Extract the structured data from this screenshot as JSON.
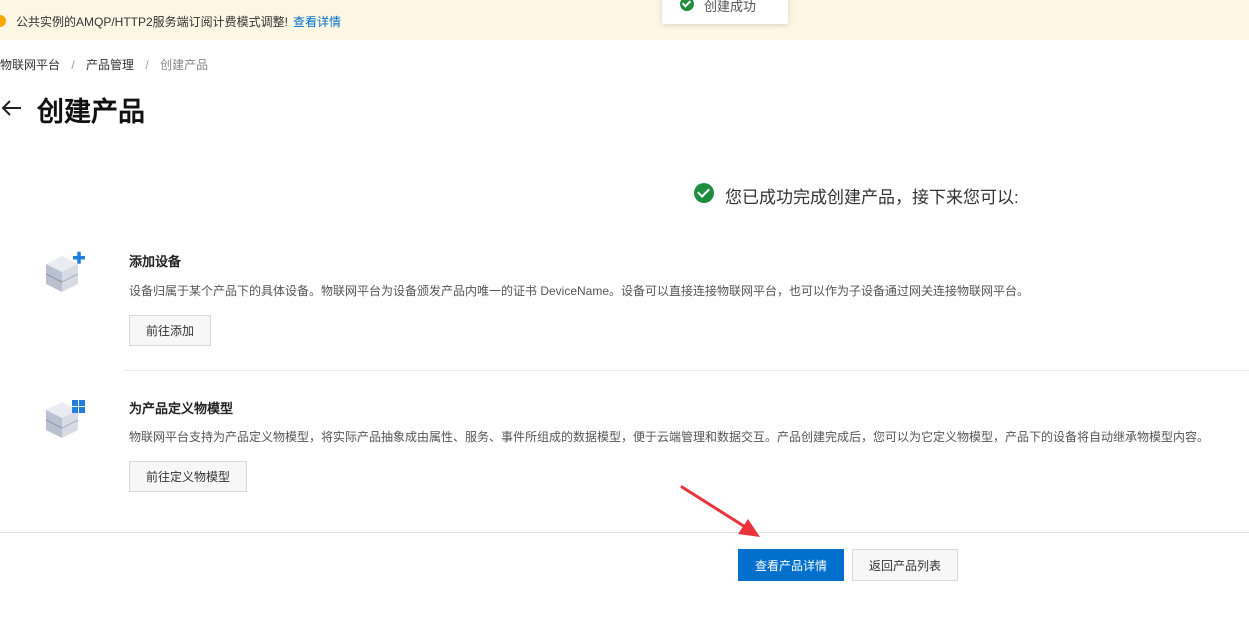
{
  "notice": {
    "text": "公共实例的AMQP/HTTP2服务端订阅计费模式调整!",
    "link": "查看详情"
  },
  "toast": {
    "text": "创建成功"
  },
  "breadcrumb": {
    "items": [
      "物联网平台",
      "产品管理",
      "创建产品"
    ],
    "separator": "/"
  },
  "page": {
    "title": "创建产品"
  },
  "success": {
    "message": "您已成功完成创建产品，接下来您可以:"
  },
  "sections": [
    {
      "title": "添加设备",
      "description": "设备归属于某个产品下的具体设备。物联网平台为设备颁发产品内唯一的证书 DeviceName。设备可以直接连接物联网平台，也可以作为子设备通过网关连接物联网平台。",
      "button": "前往添加",
      "icon": "add-device-icon"
    },
    {
      "title": "为产品定义物模型",
      "description": "物联网平台支持为产品定义物模型，将实际产品抽象成由属性、服务、事件所组成的数据模型，便于云端管理和数据交互。产品创建完成后，您可以为它定义物模型，产品下的设备将自动继承物模型内容。",
      "button": "前往定义物模型",
      "icon": "thing-model-icon"
    }
  ],
  "footer": {
    "primary": "查看产品详情",
    "secondary": "返回产品列表"
  },
  "colors": {
    "primary": "#0070cc",
    "success": "#1e8e3e",
    "notice_bg": "#fdf6e3",
    "annotation_arrow": "#e8343a"
  }
}
